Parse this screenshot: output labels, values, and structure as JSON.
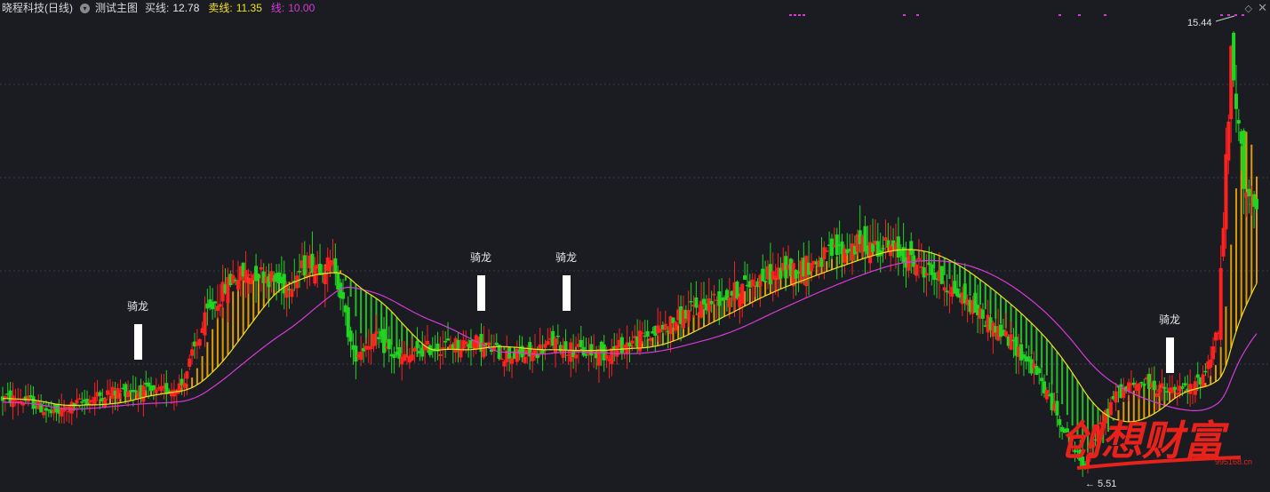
{
  "header": {
    "stock_name": "晓程科技(日线)",
    "indicator_name": "测试主图",
    "buy_label": "买线:",
    "buy_value": "12.78",
    "sell_label": "卖线:",
    "sell_value": "11.35",
    "line_label": "线:",
    "line_value": "10.00"
  },
  "annotations": {
    "high_label": "15.44",
    "low_label": "5.51",
    "signal_label": "骑龙",
    "watermark_text": "创想财富",
    "watermark_url": "995168.cn"
  },
  "icons": {
    "options": "chevron-down-icon",
    "diamond": "diamond-icon",
    "close": "close-icon"
  },
  "colors": {
    "background": "#1a1c22",
    "up_candle": "#ff2020",
    "down_candle": "#22d422",
    "buy_line": "#ffffff",
    "sell_line": "#f2e022",
    "line_color": "#d63ad6",
    "ribbon_warm": "#ffb000",
    "ribbon_cool": "#29d929",
    "signal_marker": "#ffffff",
    "watermark": "#e8221a"
  },
  "chart_data": {
    "type": "candlestick",
    "price_range": [
      5.51,
      15.44
    ],
    "high": 15.44,
    "low": 5.51,
    "signals": [
      "骑龙",
      "骑龙",
      "骑龙",
      "骑龙"
    ],
    "close_path": [
      {
        "i": 0,
        "v": 7.3
      },
      {
        "i": 10,
        "v": 7.25
      },
      {
        "i": 20,
        "v": 6.95
      },
      {
        "i": 30,
        "v": 7.2
      },
      {
        "i": 40,
        "v": 7.4
      },
      {
        "i": 50,
        "v": 7.5
      },
      {
        "i": 60,
        "v": 7.4
      },
      {
        "i": 70,
        "v": 7.6
      },
      {
        "i": 80,
        "v": 9.1
      },
      {
        "i": 90,
        "v": 9.9
      },
      {
        "i": 100,
        "v": 10.0
      },
      {
        "i": 110,
        "v": 9.7
      },
      {
        "i": 120,
        "v": 10.2
      },
      {
        "i": 130,
        "v": 10.1
      },
      {
        "i": 137,
        "v": 8.2
      },
      {
        "i": 145,
        "v": 8.6
      },
      {
        "i": 155,
        "v": 8.1
      },
      {
        "i": 165,
        "v": 8.35
      },
      {
        "i": 175,
        "v": 8.45
      },
      {
        "i": 185,
        "v": 8.5
      },
      {
        "i": 195,
        "v": 8.25
      },
      {
        "i": 205,
        "v": 8.2
      },
      {
        "i": 215,
        "v": 8.5
      },
      {
        "i": 225,
        "v": 8.3
      },
      {
        "i": 235,
        "v": 8.25
      },
      {
        "i": 245,
        "v": 8.5
      },
      {
        "i": 255,
        "v": 8.7
      },
      {
        "i": 265,
        "v": 9.05
      },
      {
        "i": 275,
        "v": 9.35
      },
      {
        "i": 285,
        "v": 9.55
      },
      {
        "i": 295,
        "v": 9.85
      },
      {
        "i": 305,
        "v": 10.0
      },
      {
        "i": 315,
        "v": 10.15
      },
      {
        "i": 325,
        "v": 10.4
      },
      {
        "i": 335,
        "v": 10.6
      },
      {
        "i": 345,
        "v": 10.55
      },
      {
        "i": 355,
        "v": 10.25
      },
      {
        "i": 365,
        "v": 9.9
      },
      {
        "i": 375,
        "v": 9.45
      },
      {
        "i": 385,
        "v": 8.95
      },
      {
        "i": 395,
        "v": 8.45
      },
      {
        "i": 405,
        "v": 7.75
      },
      {
        "i": 415,
        "v": 6.6
      },
      {
        "i": 422,
        "v": 5.85
      },
      {
        "i": 428,
        "v": 6.6
      },
      {
        "i": 435,
        "v": 7.4
      },
      {
        "i": 445,
        "v": 7.65
      },
      {
        "i": 455,
        "v": 7.45
      },
      {
        "i": 465,
        "v": 7.5
      },
      {
        "i": 470,
        "v": 7.9
      },
      {
        "i": 475,
        "v": 8.8
      },
      {
        "i": 480,
        "v": 14.5
      },
      {
        "i": 485,
        "v": 12.0
      },
      {
        "i": 490,
        "v": 11.1
      }
    ]
  }
}
